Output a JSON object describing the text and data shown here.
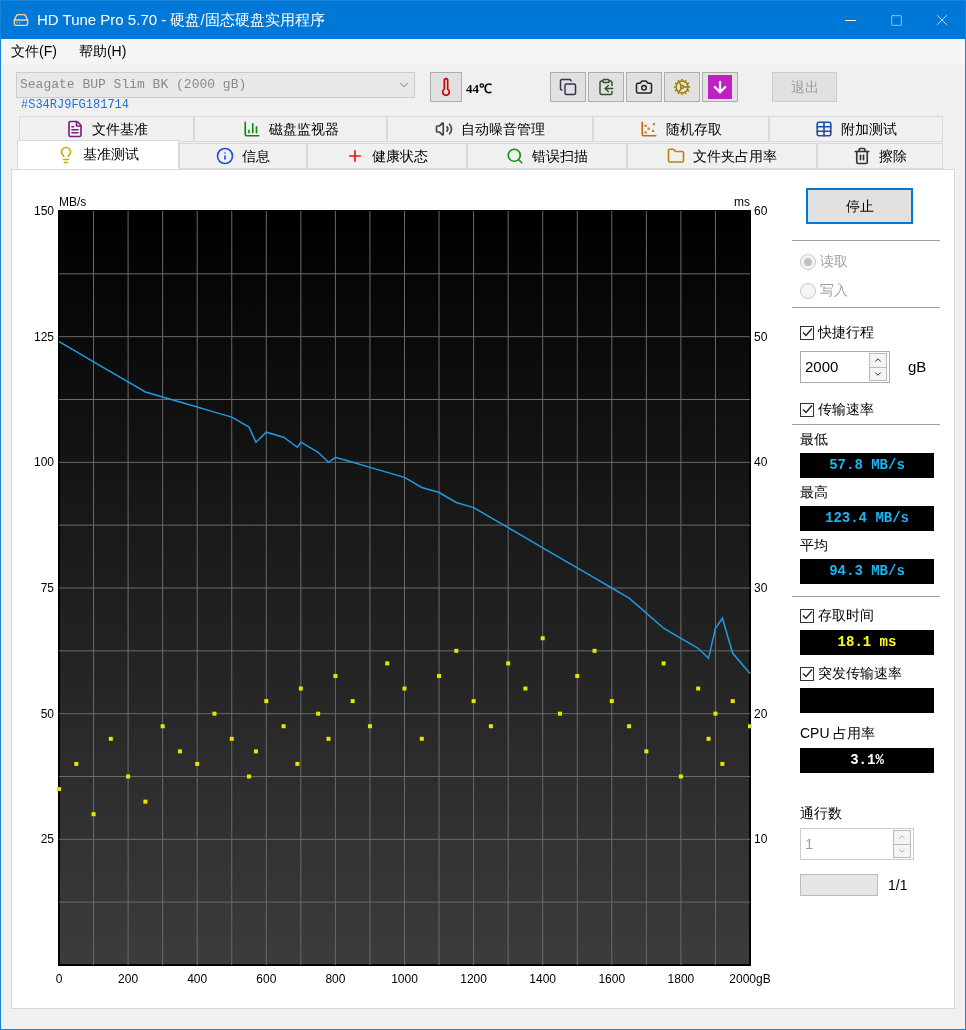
{
  "window": {
    "title": "HD Tune Pro 5.70 - 硬盘/固态硬盘实用程序"
  },
  "menu": [
    "文件(F)",
    "帮助(H)"
  ],
  "drive": {
    "value": "Seagate BUP Slim BK (2000 gB)",
    "serial": "#S34RJ9FG181714",
    "temperature": "44℃"
  },
  "toolbar": {
    "exit_button": "退出"
  },
  "tabs_row1": [
    {
      "label": "文件基准",
      "selected": false
    },
    {
      "label": "磁盘监视器",
      "selected": false
    },
    {
      "label": "自动噪音管理",
      "selected": false
    },
    {
      "label": "随机存取",
      "selected": false
    },
    {
      "label": "附加测试",
      "selected": false
    }
  ],
  "tabs_row2": [
    {
      "label": "基准测试",
      "selected": true
    },
    {
      "label": "信息",
      "selected": false
    },
    {
      "label": "健康状态",
      "selected": false
    },
    {
      "label": "错误扫描",
      "selected": false
    },
    {
      "label": "文件夹占用率",
      "selected": false
    },
    {
      "label": "擦除",
      "selected": false
    }
  ],
  "transfer_chart": {
    "chart_data": {
      "type": "line",
      "grid": true,
      "xlabel": "gB",
      "ylabel": "MB/s",
      "xlim": [
        0,
        2000
      ],
      "ylim": [
        0,
        150
      ],
      "xticks": [
        0,
        200,
        400,
        600,
        800,
        1000,
        1200,
        1400,
        1600,
        1800,
        2000
      ],
      "yticks": [
        25,
        50,
        75,
        100,
        125,
        150
      ],
      "x": [
        0,
        50,
        100,
        150,
        200,
        250,
        300,
        350,
        400,
        450,
        500,
        550,
        570,
        600,
        650,
        690,
        700,
        750,
        780,
        800,
        850,
        900,
        950,
        1000,
        1050,
        1100,
        1150,
        1200,
        1250,
        1300,
        1350,
        1400,
        1450,
        1500,
        1550,
        1600,
        1650,
        1700,
        1750,
        1800,
        1850,
        1880,
        1900,
        1920,
        1950,
        2000
      ],
      "series": [
        {
          "color": "#1e9be0",
          "values": [
            124,
            122,
            120,
            118,
            116,
            114,
            113,
            112,
            111,
            110,
            109,
            107,
            104,
            106,
            105,
            103,
            104,
            102,
            100,
            101,
            100,
            99,
            98,
            97,
            95,
            94,
            92,
            91,
            89,
            87,
            85,
            83,
            81,
            79,
            77,
            75,
            73,
            70,
            67,
            65,
            63,
            61,
            67,
            69,
            62,
            58
          ]
        }
      ]
    }
  },
  "access_chart": {
    "chart_data": {
      "type": "scatter",
      "ylabel": "ms",
      "xlim": [
        0,
        2000
      ],
      "ylim": [
        0,
        60
      ],
      "yticks": [
        10,
        20,
        30,
        40,
        50,
        60
      ],
      "x": [
        0,
        50,
        100,
        150,
        200,
        250,
        300,
        350,
        400,
        450,
        500,
        550,
        570,
        600,
        650,
        690,
        700,
        750,
        780,
        800,
        850,
        900,
        950,
        1000,
        1050,
        1100,
        1150,
        1200,
        1250,
        1300,
        1350,
        1400,
        1450,
        1500,
        1550,
        1600,
        1650,
        1700,
        1750,
        1800,
        1850,
        1880,
        1900,
        1920,
        1950,
        2000
      ],
      "series": [
        {
          "color": "#e6e600",
          "values": [
            14,
            16,
            12,
            18,
            15,
            13,
            19,
            17,
            16,
            20,
            18,
            15,
            17,
            21,
            19,
            16,
            22,
            20,
            18,
            23,
            21,
            19,
            24,
            22,
            18,
            23,
            25,
            21,
            19,
            24,
            22,
            26,
            20,
            23,
            25,
            21,
            19,
            17,
            24,
            15,
            22,
            18,
            20,
            16,
            21,
            19
          ]
        }
      ]
    }
  },
  "controls": {
    "stop_button": "停止",
    "read": {
      "label": "读取",
      "selected": true
    },
    "write": {
      "label": "写入",
      "selected": false
    },
    "short_stroke": {
      "label": "快捷行程",
      "checked": true
    },
    "stroke_value": "2000",
    "stroke_unit": "gB",
    "transfer_rate": {
      "label": "传输速率",
      "checked": true
    },
    "readouts": [
      {
        "label": "最低",
        "value": "57.8 MB/s"
      },
      {
        "label": "最高",
        "value": "123.4 MB/s"
      },
      {
        "label": "平均",
        "value": "94.3 MB/s"
      }
    ],
    "access_time": {
      "label": "存取时间",
      "checked": true,
      "value": "18.1 ms"
    },
    "burst_rate": {
      "label": "突发传输速率",
      "checked": true
    },
    "cpu": {
      "label": "CPU 占用率",
      "value": "3.1%"
    },
    "passes": {
      "label": "通行数",
      "value": "1",
      "disabled": true
    },
    "progress": {
      "level": 0,
      "text": "1/1"
    }
  }
}
